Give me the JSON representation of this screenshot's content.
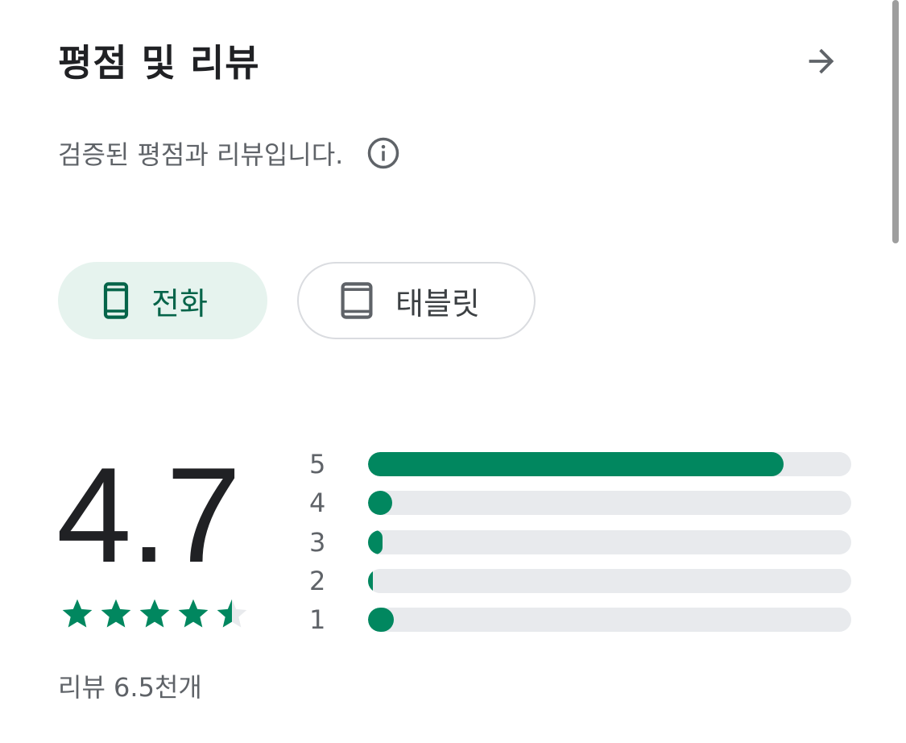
{
  "header": {
    "title": "평점 및 리뷰",
    "arrow_icon": "arrow-right-icon"
  },
  "subtitle": {
    "text": "검증된 평점과 리뷰입니다.",
    "info_icon": "info-icon"
  },
  "device_tabs": [
    {
      "label": "전화",
      "icon": "phone-icon",
      "selected": true
    },
    {
      "label": "태블릿",
      "icon": "tablet-icon",
      "selected": false
    }
  ],
  "rating": {
    "value": "4.7",
    "stars_filled": 4.5,
    "review_count": "리뷰 6.5천개"
  },
  "distribution": [
    {
      "label": "5",
      "fraction": 0.86
    },
    {
      "label": "4",
      "fraction": 0.05
    },
    {
      "label": "3",
      "fraction": 0.03
    },
    {
      "label": "2",
      "fraction": 0.01
    },
    {
      "label": "1",
      "fraction": 0.053
    }
  ],
  "colors": {
    "accent": "#01875f",
    "accent_dark": "#056449",
    "chip_selected_bg": "#e6f3ee",
    "track": "#e8eaed",
    "text_primary": "#202124",
    "text_secondary": "#5f6368"
  }
}
